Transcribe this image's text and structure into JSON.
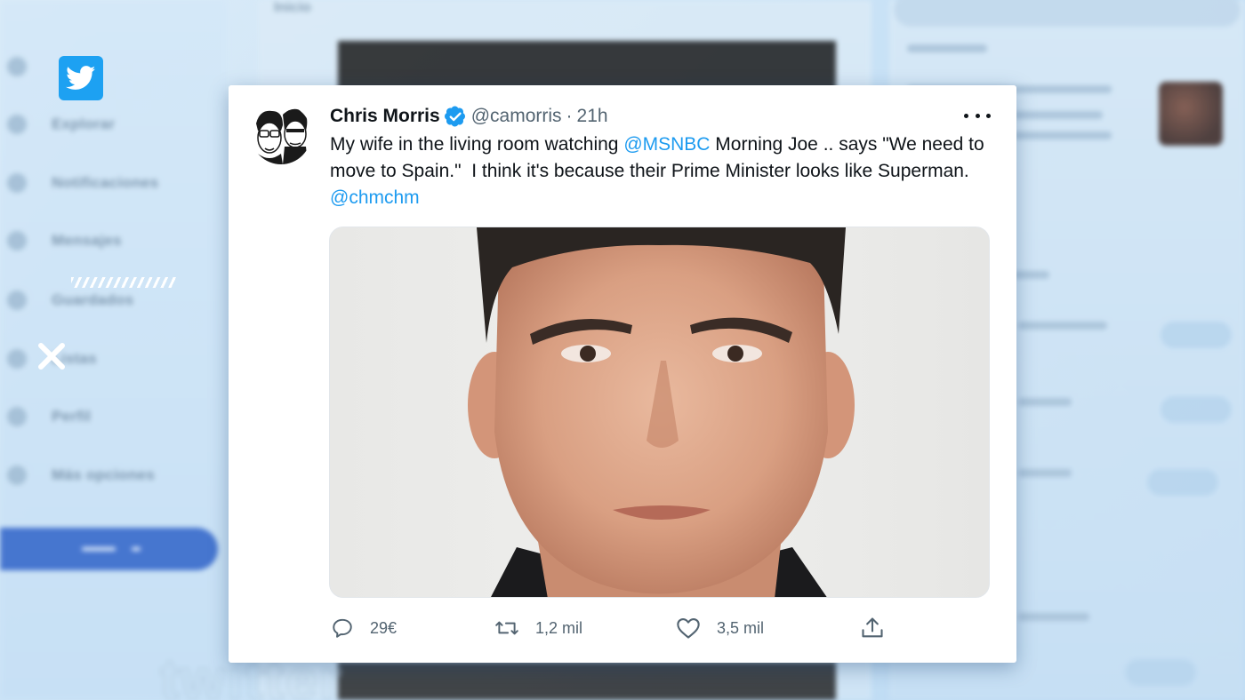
{
  "background": {
    "center_title": "Inicio",
    "nav_items": [
      {
        "label": "",
        "icon": "home-icon"
      },
      {
        "label": "Explorar",
        "icon": "hashtag-icon"
      },
      {
        "label": "Notificaciones",
        "icon": "bell-icon"
      },
      {
        "label": "Mensajes",
        "icon": "mail-icon"
      },
      {
        "label": "Guardados",
        "icon": "bookmark-icon"
      },
      {
        "label": "Listas",
        "icon": "list-icon"
      },
      {
        "label": "Perfil",
        "icon": "profile-icon"
      },
      {
        "label": "Más opciones",
        "icon": "more-circle-icon"
      }
    ],
    "watermark_word": "twitter"
  },
  "tweet": {
    "author_name": "Chris Morris",
    "handle": "@camorris",
    "separator": "·",
    "time": "21h",
    "text_before_mention": "My wife in the living room watching ",
    "mention_1": "@MSNBC",
    "text_after_mention": " Morning Joe .. says \"We need to move to Spain.\"  I think it's because their Prime Minister looks like Superman. ",
    "mention_2": "@chmchm",
    "actions": {
      "reply_count": "29€",
      "retweet_count": "1,2 mil",
      "like_count": "3,5 mil"
    }
  },
  "colors": {
    "twitter_blue": "#1d9bf0",
    "verified_blue": "#1d9bf0",
    "text_primary": "#0f1419",
    "text_secondary": "#536471"
  }
}
